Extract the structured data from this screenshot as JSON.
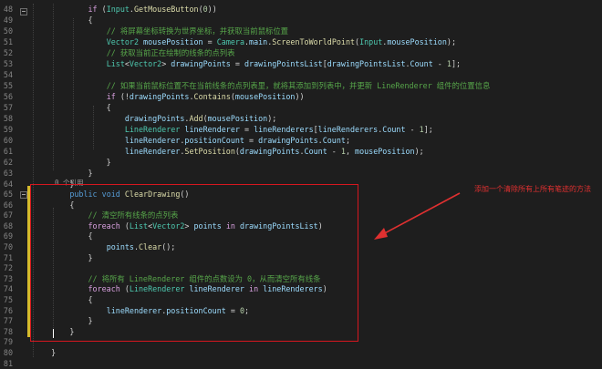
{
  "editor": {
    "lines": [
      {
        "n": "48",
        "segs": [
          [
            "            ",
            "p"
          ],
          [
            "if",
            "ctl"
          ],
          [
            " (",
            "p"
          ],
          [
            "Input",
            "type"
          ],
          [
            ".",
            "p"
          ],
          [
            "GetMouseButton",
            "fn"
          ],
          [
            "(",
            "p"
          ],
          [
            "0",
            "num"
          ],
          [
            "))",
            "p"
          ]
        ]
      },
      {
        "n": "49",
        "segs": [
          [
            "            {",
            "p"
          ]
        ]
      },
      {
        "n": "50",
        "segs": [
          [
            "                ",
            "p"
          ],
          [
            "// 将屏幕坐标转换为世界坐标，并获取当前鼠标位置",
            "cm"
          ]
        ]
      },
      {
        "n": "51",
        "segs": [
          [
            "                ",
            "p"
          ],
          [
            "Vector2",
            "type"
          ],
          [
            " ",
            "p"
          ],
          [
            "mousePosition",
            "var"
          ],
          [
            " = ",
            "p"
          ],
          [
            "Camera",
            "type"
          ],
          [
            ".",
            "p"
          ],
          [
            "main",
            "var"
          ],
          [
            ".",
            "p"
          ],
          [
            "ScreenToWorldPoint",
            "fn"
          ],
          [
            "(",
            "p"
          ],
          [
            "Input",
            "type"
          ],
          [
            ".",
            "p"
          ],
          [
            "mousePosition",
            "var"
          ],
          [
            ");",
            "p"
          ]
        ]
      },
      {
        "n": "52",
        "segs": [
          [
            "                ",
            "p"
          ],
          [
            "// 获取当前正在绘制的线条的点列表",
            "cm"
          ]
        ]
      },
      {
        "n": "53",
        "segs": [
          [
            "                ",
            "p"
          ],
          [
            "List",
            "type"
          ],
          [
            "<",
            "p"
          ],
          [
            "Vector2",
            "type"
          ],
          [
            "> ",
            "p"
          ],
          [
            "drawingPoints",
            "var"
          ],
          [
            " = ",
            "p"
          ],
          [
            "drawingPointsList",
            "var"
          ],
          [
            "[",
            "p"
          ],
          [
            "drawingPointsList",
            "var"
          ],
          [
            ".",
            "p"
          ],
          [
            "Count",
            "var"
          ],
          [
            " - ",
            "p"
          ],
          [
            "1",
            "num"
          ],
          [
            "];",
            "p"
          ]
        ]
      },
      {
        "n": "54",
        "segs": []
      },
      {
        "n": "55",
        "segs": [
          [
            "                ",
            "p"
          ],
          [
            "// 如果当前鼠标位置不在当前线条的点列表里，就将其添加到列表中，并更新 LineRenderer 组件的位置信息",
            "cm"
          ]
        ]
      },
      {
        "n": "56",
        "segs": [
          [
            "                ",
            "p"
          ],
          [
            "if",
            "ctl"
          ],
          [
            " (!",
            "p"
          ],
          [
            "drawingPoints",
            "var"
          ],
          [
            ".",
            "p"
          ],
          [
            "Contains",
            "fn"
          ],
          [
            "(",
            "p"
          ],
          [
            "mousePosition",
            "var"
          ],
          [
            "))",
            "p"
          ]
        ]
      },
      {
        "n": "57",
        "segs": [
          [
            "                {",
            "p"
          ]
        ]
      },
      {
        "n": "58",
        "segs": [
          [
            "                    ",
            "p"
          ],
          [
            "drawingPoints",
            "var"
          ],
          [
            ".",
            "p"
          ],
          [
            "Add",
            "fn"
          ],
          [
            "(",
            "p"
          ],
          [
            "mousePosition",
            "var"
          ],
          [
            ");",
            "p"
          ]
        ]
      },
      {
        "n": "59",
        "segs": [
          [
            "                    ",
            "p"
          ],
          [
            "LineRenderer",
            "type"
          ],
          [
            " ",
            "p"
          ],
          [
            "lineRenderer",
            "var"
          ],
          [
            " = ",
            "p"
          ],
          [
            "lineRenderers",
            "var"
          ],
          [
            "[",
            "p"
          ],
          [
            "lineRenderers",
            "var"
          ],
          [
            ".",
            "p"
          ],
          [
            "Count",
            "var"
          ],
          [
            " - ",
            "p"
          ],
          [
            "1",
            "num"
          ],
          [
            "];",
            "p"
          ]
        ]
      },
      {
        "n": "60",
        "segs": [
          [
            "                    ",
            "p"
          ],
          [
            "lineRenderer",
            "var"
          ],
          [
            ".",
            "p"
          ],
          [
            "positionCount",
            "var"
          ],
          [
            " = ",
            "p"
          ],
          [
            "drawingPoints",
            "var"
          ],
          [
            ".",
            "p"
          ],
          [
            "Count",
            "var"
          ],
          [
            ";",
            "p"
          ]
        ]
      },
      {
        "n": "61",
        "segs": [
          [
            "                    ",
            "p"
          ],
          [
            "lineRenderer",
            "var"
          ],
          [
            ".",
            "p"
          ],
          [
            "SetPosition",
            "fn"
          ],
          [
            "(",
            "p"
          ],
          [
            "drawingPoints",
            "var"
          ],
          [
            ".",
            "p"
          ],
          [
            "Count",
            "var"
          ],
          [
            " - ",
            "p"
          ],
          [
            "1",
            "num"
          ],
          [
            ", ",
            "p"
          ],
          [
            "mousePosition",
            "var"
          ],
          [
            ");",
            "p"
          ]
        ]
      },
      {
        "n": "62",
        "segs": [
          [
            "                }",
            "p"
          ]
        ]
      },
      {
        "n": "63",
        "segs": [
          [
            "            }",
            "p"
          ]
        ]
      },
      {
        "n": "64",
        "segs": [
          [
            "        }",
            "p"
          ]
        ]
      },
      {
        "n": "65",
        "segs": [
          [
            "        ",
            "p"
          ],
          [
            "public",
            "kw"
          ],
          [
            " ",
            "p"
          ],
          [
            "void",
            "kw"
          ],
          [
            " ",
            "p"
          ],
          [
            "ClearDrawing",
            "fn"
          ],
          [
            "()",
            "p"
          ]
        ]
      },
      {
        "n": "66",
        "segs": [
          [
            "        {",
            "p"
          ]
        ]
      },
      {
        "n": "67",
        "segs": [
          [
            "            ",
            "p"
          ],
          [
            "// 清空所有线条的点列表",
            "cm"
          ]
        ]
      },
      {
        "n": "68",
        "segs": [
          [
            "            ",
            "p"
          ],
          [
            "foreach",
            "ctl"
          ],
          [
            " (",
            "p"
          ],
          [
            "List",
            "type"
          ],
          [
            "<",
            "p"
          ],
          [
            "Vector2",
            "type"
          ],
          [
            "> ",
            "p"
          ],
          [
            "points",
            "var"
          ],
          [
            " ",
            "p"
          ],
          [
            "in",
            "ctl"
          ],
          [
            " ",
            "p"
          ],
          [
            "drawingPointsList",
            "var"
          ],
          [
            ")",
            "p"
          ]
        ]
      },
      {
        "n": "69",
        "segs": [
          [
            "            {",
            "p"
          ]
        ]
      },
      {
        "n": "70",
        "segs": [
          [
            "                ",
            "p"
          ],
          [
            "points",
            "var"
          ],
          [
            ".",
            "p"
          ],
          [
            "Clear",
            "fn"
          ],
          [
            "();",
            "p"
          ]
        ]
      },
      {
        "n": "71",
        "segs": [
          [
            "            }",
            "p"
          ]
        ]
      },
      {
        "n": "72",
        "segs": []
      },
      {
        "n": "73",
        "segs": [
          [
            "            ",
            "p"
          ],
          [
            "// 将所有 LineRenderer 组件的点数设为 0，从而清空所有线条",
            "cm"
          ]
        ]
      },
      {
        "n": "74",
        "segs": [
          [
            "            ",
            "p"
          ],
          [
            "foreach",
            "ctl"
          ],
          [
            " (",
            "p"
          ],
          [
            "LineRenderer",
            "type"
          ],
          [
            " ",
            "p"
          ],
          [
            "lineRenderer",
            "var"
          ],
          [
            " ",
            "p"
          ],
          [
            "in",
            "ctl"
          ],
          [
            " ",
            "p"
          ],
          [
            "lineRenderers",
            "var"
          ],
          [
            ")",
            "p"
          ]
        ]
      },
      {
        "n": "75",
        "segs": [
          [
            "            {",
            "p"
          ]
        ]
      },
      {
        "n": "76",
        "segs": [
          [
            "                ",
            "p"
          ],
          [
            "lineRenderer",
            "var"
          ],
          [
            ".",
            "p"
          ],
          [
            "positionCount",
            "var"
          ],
          [
            " = ",
            "p"
          ],
          [
            "0",
            "num"
          ],
          [
            ";",
            "p"
          ]
        ]
      },
      {
        "n": "77",
        "segs": [
          [
            "            }",
            "p"
          ]
        ]
      },
      {
        "n": "78",
        "segs": [
          [
            "        }",
            "p"
          ]
        ]
      },
      {
        "n": "79",
        "segs": []
      },
      {
        "n": "80",
        "segs": [
          [
            "    }",
            "p"
          ]
        ]
      },
      {
        "n": "81",
        "segs": []
      }
    ],
    "reference_count": "0 个引用"
  },
  "annotation": {
    "text": "添加一个清除所有上所有笔迹的方法",
    "color": "#e03030"
  },
  "colors": {
    "background": "#1e1e1e",
    "keyword": "#569cd6",
    "control": "#d8a0df",
    "type": "#4ec9b0",
    "method": "#dcdcaa",
    "variable": "#9cdcfe",
    "comment": "#57a64a",
    "number": "#b5cea8",
    "highlight_box": "#d6171f",
    "change_marker": "#d7ba2c"
  }
}
